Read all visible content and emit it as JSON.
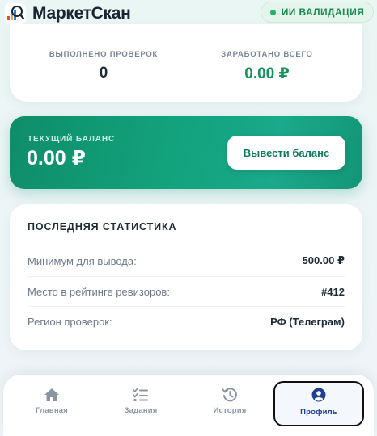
{
  "header": {
    "app_title": "МаркетСкан",
    "logo_icon": "magnifier-logo-icon",
    "ai_badge": "ИИ ВАЛИДАЦИЯ"
  },
  "stats": {
    "checks_label": "ВЫПОЛНЕНО ПРОВЕРОК",
    "checks_value": "0",
    "earned_label": "ЗАРАБОТАНО ВСЕГО",
    "earned_value": "0.00 ₽"
  },
  "balance": {
    "label": "ТЕКУЩИЙ БАЛАНС",
    "value": "0.00 ₽",
    "withdraw_button": "Вывести баланс"
  },
  "recent": {
    "title": "ПОСЛЕДНЯЯ СТАТИСТИКА",
    "rows": [
      {
        "label": "Минимум для вывода:",
        "value": "500.00 ₽"
      },
      {
        "label": "Место в рейтинге ревизоров:",
        "value": "#412"
      },
      {
        "label": "Регион проверок:",
        "value": "РФ (Телеграм)"
      }
    ]
  },
  "nav": {
    "items": [
      {
        "label": "Главная",
        "icon": "home-icon"
      },
      {
        "label": "Задания",
        "icon": "checklist-icon"
      },
      {
        "label": "История",
        "icon": "history-icon"
      },
      {
        "label": "Профиль",
        "icon": "user-circle-icon",
        "active": true
      }
    ]
  },
  "colors": {
    "accent_green": "#12a27c",
    "badge_green": "#168a4e",
    "active_nav": "#1f3f8f"
  }
}
